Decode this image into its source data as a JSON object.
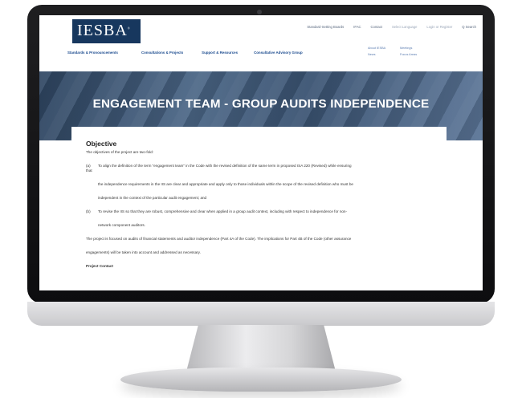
{
  "header": {
    "logo_text": "IESBA",
    "top_links": [
      "Standard-Setting Boards",
      "IFAC",
      "Contact",
      "Select Language",
      "Login or Register",
      "Q Search"
    ]
  },
  "main_nav": [
    "Standards & Pronouncements",
    "Consultations & Projects",
    "Support & Resources",
    "Consultative Advisory Group"
  ],
  "side_links": [
    "About IESBA",
    "Meetings",
    "News",
    "Focus Areas"
  ],
  "hero": {
    "title": "ENGAGEMENT TEAM - GROUP AUDITS INDEPENDENCE"
  },
  "content": {
    "heading": "Objective",
    "intro": "The objectives of the project are two-fold:",
    "item_a_marker": "(a)",
    "item_a_line1": "To align the definition of the term \"engagement team\" in the Code with the revised definition of the same term in proposed ISA 220 (Revised) while ensuring",
    "item_a_line2": "that",
    "item_a_line3": "the independence requirements in the IIS are clear and appropriate and apply only to those individuals within the scope of the revised definition who must be",
    "item_a_line4": "independent in the context of the particular audit engagement; and",
    "item_b_marker": "(b)",
    "item_b_line1": "To revise the IIS so that they are robust, comprehensive and clear when applied in a group audit context, including with respect to independence for non-",
    "item_b_line2": "network component auditors.",
    "para_line1": "The project is focused on audits of financial statements and auditor independence (Part 4A of the Code). The implications for Part 4B of the Code (other assurance",
    "para_line2": "engagements) will be taken into account and addressed as necessary.",
    "contact_heading": "Project Contact"
  }
}
